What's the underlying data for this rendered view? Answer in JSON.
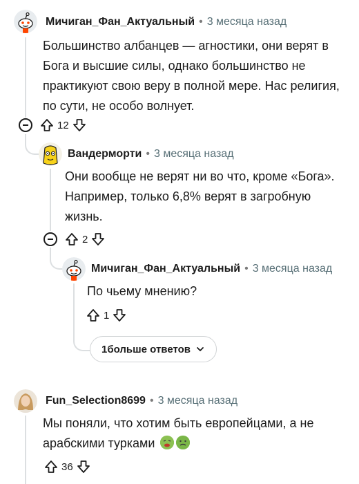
{
  "comments": [
    {
      "author": "Мичиган_Фан_Актуальный",
      "time": "3 месяца назад",
      "text": "Большинство албанцев — агностики, они верят в Бога и высшие силы, однако большинство не практикуют свою веру в полной мере. Нас религия, по сути, не особо волнует.",
      "score": "12"
    },
    {
      "author": "Вандерморти",
      "time": "3 месяца назад",
      "text": "Они вообще не верят ни во что, кроме «Бога». Например, только 6,8% верят в загробную жизнь.",
      "score": "2"
    },
    {
      "author": "Мичиган_Фан_Актуальный",
      "time": "3 месяца назад",
      "text": "По чьему мнению?",
      "score": "1"
    },
    {
      "author": "Fun_Selection8699",
      "time": "3 месяца назад",
      "text": "Мы поняли, что хотим быть европейцами, а не арабскими турками",
      "score": "36"
    }
  ],
  "more_replies": {
    "count": "1",
    "label": "больше ответов"
  },
  "icons": [
    "reddit-snoo-avatar-icon",
    "banana-avatar-icon",
    "upvote-icon",
    "downvote-icon",
    "collapse-icon",
    "chevron-down-icon",
    "nauseated-face-emoji",
    "nauseated-face-emoji"
  ]
}
